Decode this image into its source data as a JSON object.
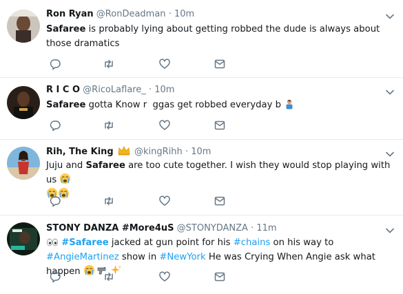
{
  "tweets": [
    {
      "name": "Ron Ryan",
      "handle": "@RonDeadman",
      "sep": "·",
      "time": "10m",
      "text": [
        {
          "t": "Safaree",
          "b": true
        },
        {
          "t": " is probably lying about getting robbed the dude is always about those dramatics"
        }
      ]
    },
    {
      "name": "R I C O",
      "handle": "@RicoLaflare_",
      "sep": "·",
      "time": "10m",
      "text": [
        {
          "t": "Safaree",
          "b": true
        },
        {
          "t": " gotta Know r  ggas get robbed everyday b "
        }
      ],
      "emoji": [
        "man-gesturing-emoji"
      ]
    },
    {
      "name": "Rih, The King",
      "handle": "@kingRihh",
      "sep": "·",
      "time": "10m",
      "badge": "crown-icon",
      "text": [
        {
          "t": "Juju and "
        },
        {
          "t": "Safaree",
          "b": true
        },
        {
          "t": " are too cute together. I wish they would stop playing with us "
        }
      ],
      "emoji": [
        "crying-face-emoji",
        "crying-face-emoji",
        "crying-face-emoji"
      ]
    },
    {
      "name": "STONY DANZA #More4uS",
      "handle": "@STONYDANZA",
      "sep": "·",
      "time": "11m",
      "text": [
        {
          "t": "#Safaree",
          "h": true
        },
        {
          "t": " jacked at gun point for his "
        },
        {
          "t": "#chains",
          "h": true
        },
        {
          "t": " on his way to "
        },
        {
          "t": "#AngieMartinez",
          "h": true
        },
        {
          "t": " show in "
        },
        {
          "t": "#NewYork",
          "h": true
        },
        {
          "t": " He was Crying When Angie ask what happen "
        }
      ],
      "emoji": [
        "eyes-emoji",
        "crying-face-emoji",
        "pistol-emoji",
        "sparkles-emoji"
      ]
    }
  ],
  "icons": {
    "reply": "reply-icon",
    "retweet": "retweet-icon",
    "like": "heart-icon",
    "dm": "envelope-icon",
    "more": "chevron-down-icon"
  },
  "colors": {
    "icon": "#657786",
    "hashtag": "#1da1f2",
    "separator": "#e6ecf0",
    "text": "#14171a"
  }
}
